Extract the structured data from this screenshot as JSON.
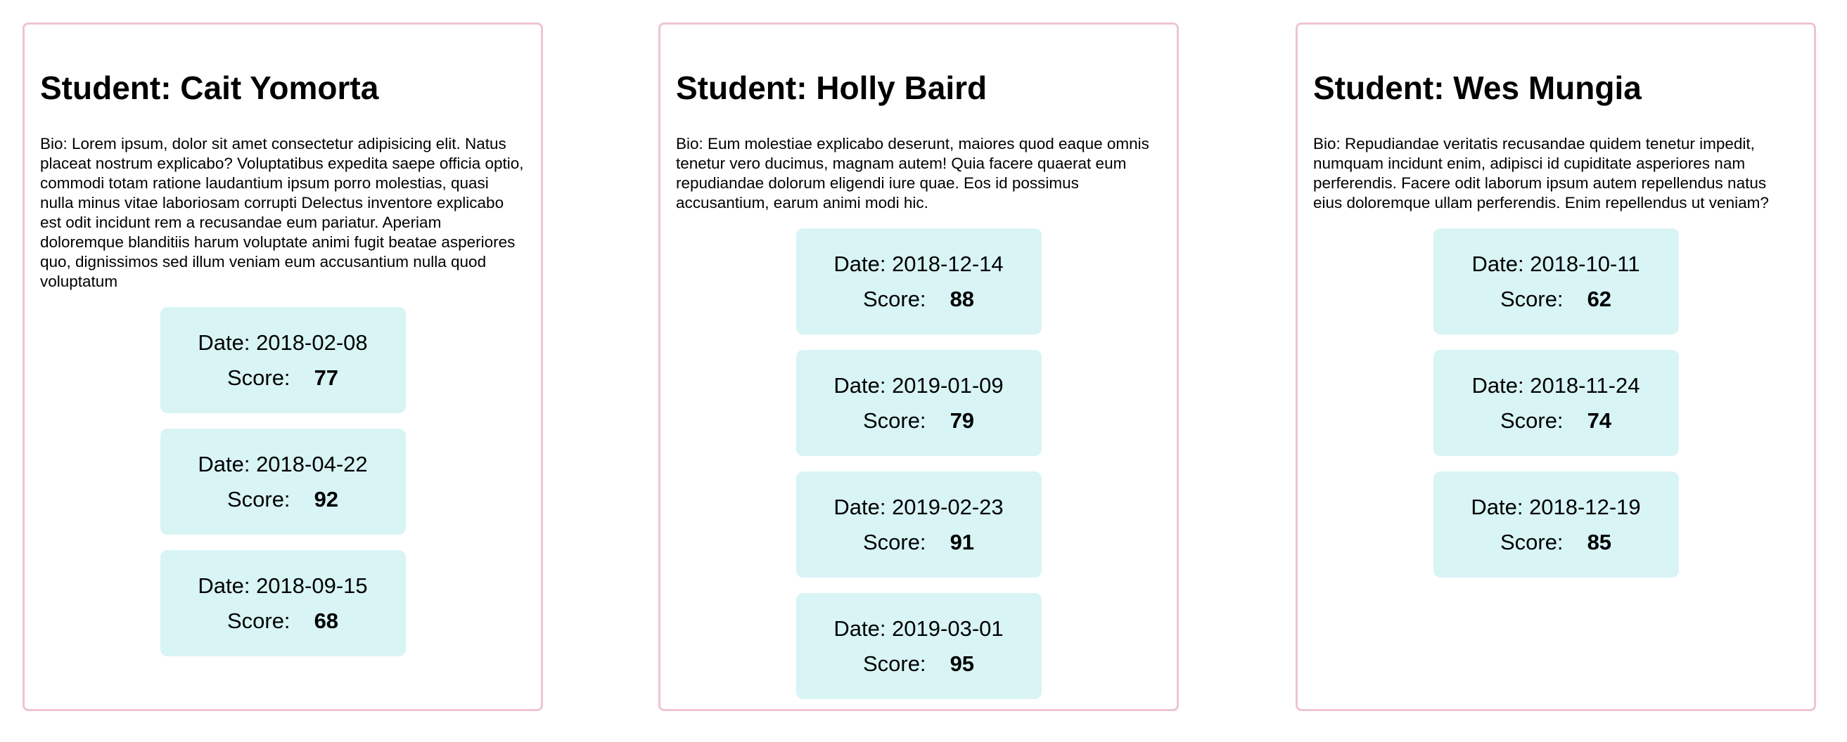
{
  "students": [
    {
      "title": "Student: Cait Yomorta",
      "bio": "Bio: Lorem ipsum, dolor sit amet consectetur adipisicing elit. Natus placeat nostrum explicabo? Voluptatibus expedita saepe officia optio, commodi totam ratione laudantium ipsum porro molestias, quasi nulla minus vitae laboriosam corrupti Delectus inventore explicabo est odit incidunt rem a recusandae eum pariatur. Aperiam doloremque blanditiis harum voluptate animi fugit beatae asperiores quo, dignissimos sed illum veniam eum accusantium nulla quod voluptatum",
      "scores": [
        {
          "date": "Date: 2018-02-08",
          "label": "Score:",
          "value": "77"
        },
        {
          "date": "Date: 2018-04-22",
          "label": "Score:",
          "value": "92"
        },
        {
          "date": "Date: 2018-09-15",
          "label": "Score:",
          "value": "68"
        }
      ]
    },
    {
      "title": "Student: Holly Baird",
      "bio": "Bio: Eum molestiae explicabo deserunt, maiores quod eaque omnis tenetur vero ducimus, magnam autem! Quia facere quaerat eum repudiandae dolorum eligendi iure quae. Eos id possimus accusantium, earum animi modi hic.",
      "scores": [
        {
          "date": "Date: 2018-12-14",
          "label": "Score:",
          "value": "88"
        },
        {
          "date": "Date: 2019-01-09",
          "label": "Score:",
          "value": "79"
        },
        {
          "date": "Date: 2019-02-23",
          "label": "Score:",
          "value": "91"
        },
        {
          "date": "Date: 2019-03-01",
          "label": "Score:",
          "value": "95"
        }
      ]
    },
    {
      "title": "Student: Wes Mungia",
      "bio": "Bio: Repudiandae veritatis recusandae quidem tenetur impedit, numquam incidunt enim, adipisci id cupiditate asperiores nam perferendis. Facere odit laborum ipsum autem repellendus natus eius doloremque ullam perferendis. Enim repellendus ut veniam?",
      "scores": [
        {
          "date": "Date: 2018-10-11",
          "label": "Score:",
          "value": "62"
        },
        {
          "date": "Date: 2018-11-24",
          "label": "Score:",
          "value": "74"
        },
        {
          "date": "Date: 2018-12-19",
          "label": "Score:",
          "value": "85"
        }
      ]
    }
  ],
  "colors": {
    "border": "#eec4d3",
    "score_bg": "#d8f4f5"
  }
}
